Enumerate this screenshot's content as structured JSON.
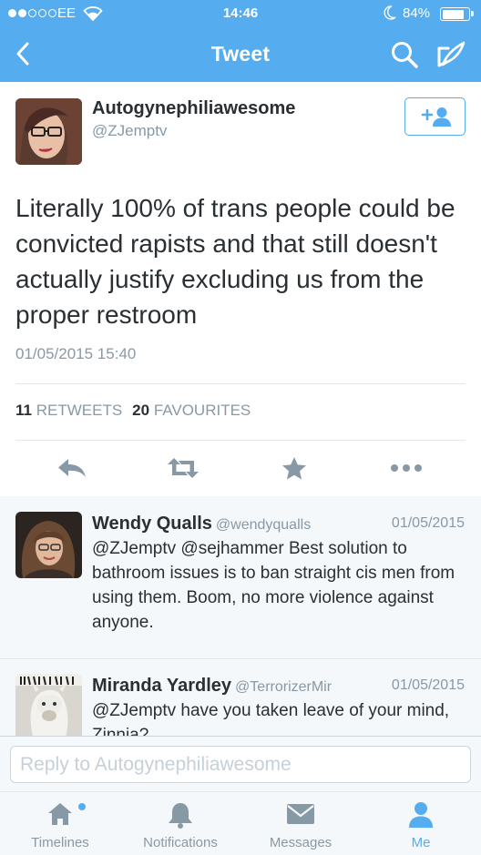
{
  "status_bar": {
    "carrier": "EE",
    "time": "14:46",
    "battery": "84%"
  },
  "nav": {
    "title": "Tweet",
    "back_icon": "chevron-left-icon",
    "search_icon": "search-icon",
    "compose_icon": "compose-icon"
  },
  "tweet": {
    "author_name": "Autogynephiliawesome",
    "author_handle": "@ZJemptv",
    "text": "Literally 100% of trans people could be convicted rapists and that still doesn't actually justify excluding us from the proper restroom",
    "timestamp": "01/05/2015 15:40",
    "retweets_count": "11",
    "retweets_label": "RETWEETS",
    "favourites_count": "20",
    "favourites_label": "FAVOURITES"
  },
  "replies": [
    {
      "name": "Wendy Qualls",
      "handle": "@wendyqualls",
      "date": "01/05/2015",
      "text": "@ZJemptv @sejhammer Best solution to bathroom issues is to ban straight cis men from using them.  Boom, no more violence against anyone."
    },
    {
      "name": "Miranda Yardley",
      "handle": "@TerrorizerMir",
      "date": "01/05/2015",
      "text": "@ZJemptv have you taken leave of your mind, Zinnia?"
    }
  ],
  "reply_box": {
    "placeholder": "Reply to Autogynephiliawesome"
  },
  "tabs": [
    {
      "label": "Timelines",
      "icon": "home-icon"
    },
    {
      "label": "Notifications",
      "icon": "bell-icon"
    },
    {
      "label": "Messages",
      "icon": "envelope-icon"
    },
    {
      "label": "Me",
      "icon": "person-icon"
    }
  ],
  "colors": {
    "brand": "#55acee",
    "text": "#292f33",
    "muted": "#8899a6",
    "icon_gray": "#8899a6"
  }
}
